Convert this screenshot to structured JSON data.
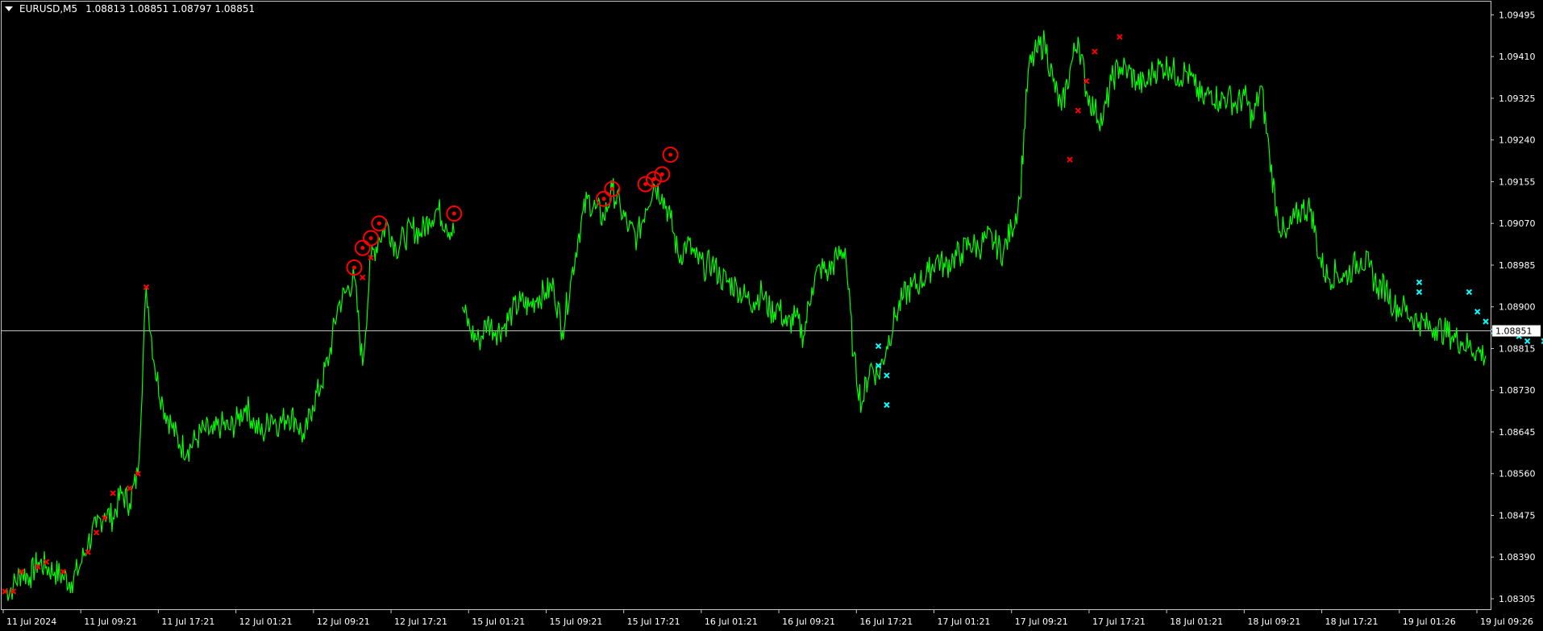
{
  "header": {
    "symbol": "EURUSD,M5",
    "ohlc": "1.08813 1.08851 1.08797 1.08851"
  },
  "colors": {
    "background": "#000000",
    "price_line": "#00ff00",
    "sell_marker": "#ff0000",
    "buy_marker": "#00ffff",
    "grid_text": "#ffffff",
    "bid_line": "#c0c0c0"
  },
  "chart_data": {
    "type": "line",
    "series": [
      {
        "values": [
          1.0832,
          1.0833,
          1.0836,
          1.0835,
          1.0838,
          1.0837,
          1.0836,
          1.0835,
          1.0834,
          1.0837,
          1.0842,
          1.0845,
          1.0848,
          1.0847,
          1.0852,
          1.085,
          1.0856,
          1.0894,
          1.0878,
          1.087,
          1.0866,
          1.0862,
          1.0861,
          1.0863,
          1.0865,
          1.0864,
          1.0866,
          1.0865,
          1.0867,
          1.087,
          1.0866,
          1.0864,
          1.0868,
          1.0866,
          1.0868,
          1.0867,
          1.0863,
          1.087,
          1.0874,
          1.088,
          1.089,
          1.0893,
          1.0896,
          1.0878,
          1.09,
          1.0904,
          1.0907,
          1.0902,
          1.0904,
          1.0906,
          1.0905,
          1.0908,
          1.091,
          1.0907,
          1.0905,
          1.089,
          1.0885,
          1.0883,
          1.0887,
          1.0885,
          1.0886,
          1.0889,
          1.0891,
          1.089,
          1.0892,
          1.0893,
          1.0894,
          1.0885,
          1.0895,
          1.0905,
          1.0912,
          1.091,
          1.0908,
          1.0914,
          1.091,
          1.0906,
          1.0904,
          1.091,
          1.0915,
          1.0913,
          1.0908,
          1.09,
          1.0903,
          1.09,
          1.0898,
          1.0899,
          1.0896,
          1.0895,
          1.0894,
          1.0892,
          1.0891,
          1.0893,
          1.0889,
          1.089,
          1.0886,
          1.0888,
          1.0884,
          1.0894,
          1.0898,
          1.0897,
          1.09,
          1.0902,
          1.088,
          1.087,
          1.0878,
          1.0876,
          1.0882,
          1.0888,
          1.0892,
          1.0894,
          1.0895,
          1.0897,
          1.09,
          1.0898,
          1.09,
          1.0901,
          1.0903,
          1.0902,
          1.0904,
          1.0903,
          1.0901,
          1.0906,
          1.0912,
          1.0938,
          1.0942,
          1.0944,
          1.0936,
          1.093,
          1.0938,
          1.0945,
          1.0934,
          1.093,
          1.0928,
          1.0936,
          1.0939,
          1.0938,
          1.0936,
          1.0935,
          1.0938,
          1.0939,
          1.0939,
          1.0937,
          1.0938,
          1.0935,
          1.0932,
          1.0934,
          1.0932,
          1.0933,
          1.0931,
          1.0933,
          1.0928,
          1.0935,
          1.0921,
          1.0908,
          1.0904,
          1.0908,
          1.091,
          1.091,
          1.09,
          1.0896,
          1.0897,
          1.0896,
          1.0898,
          1.09,
          1.0898,
          1.0894,
          1.0894,
          1.089,
          1.089,
          1.0888,
          1.0887,
          1.0886,
          1.0886,
          1.0885,
          1.0884,
          1.0883,
          1.0882,
          1.0881,
          1.088
        ]
      }
    ],
    "gap_after_index": 54,
    "x_ticks": [
      "11 Jul 2024",
      "11 Jul 09:21",
      "11 Jul 17:21",
      "12 Jul 01:21",
      "12 Jul 09:21",
      "12 Jul 17:21",
      "15 Jul 01:21",
      "15 Jul 09:21",
      "15 Jul 17:21",
      "16 Jul 01:21",
      "16 Jul 09:21",
      "16 Jul 17:21",
      "17 Jul 01:21",
      "17 Jul 09:21",
      "17 Jul 17:21",
      "18 Jul 01:21",
      "18 Jul 09:21",
      "18 Jul 17:21",
      "19 Jul 01:26",
      "19 Jul 09:26"
    ],
    "y_ticks": [
      "1.09495",
      "1.09410",
      "1.09325",
      "1.09240",
      "1.09155",
      "1.09070",
      "1.08985",
      "1.08900",
      "1.08815",
      "1.08730",
      "1.08645",
      "1.08560",
      "1.08475",
      "1.08390",
      "1.08305"
    ],
    "ylim": [
      1.08282,
      1.09522
    ],
    "current_price": "1.08851",
    "sell_markers": [
      [
        0,
        1.0832
      ],
      [
        1,
        1.0832
      ],
      [
        2,
        1.0836
      ],
      [
        4,
        1.0837
      ],
      [
        5,
        1.0838
      ],
      [
        7,
        1.0836
      ],
      [
        10,
        1.084
      ],
      [
        11,
        1.0844
      ],
      [
        12,
        1.0847
      ],
      [
        13,
        1.0852
      ],
      [
        15,
        1.0853
      ],
      [
        16,
        1.0856
      ],
      [
        17,
        1.0894
      ],
      [
        43,
        1.0896
      ],
      [
        44,
        1.09
      ],
      [
        128,
        1.092
      ],
      [
        129,
        1.093
      ],
      [
        130,
        1.0936
      ],
      [
        131,
        1.0942
      ],
      [
        134,
        1.0945
      ]
    ],
    "sell_circles": [
      [
        42,
        1.0898
      ],
      [
        43,
        1.0902
      ],
      [
        44,
        1.0904
      ],
      [
        45,
        1.0907
      ],
      [
        54,
        1.0909
      ],
      [
        72,
        1.0912
      ],
      [
        73,
        1.0914
      ],
      [
        77,
        1.0915
      ],
      [
        78,
        1.0916
      ],
      [
        79,
        1.0917
      ],
      [
        80,
        1.0921
      ]
    ],
    "buy_markers": [
      [
        105,
        1.0882
      ],
      [
        105,
        1.0878
      ],
      [
        106,
        1.0876
      ],
      [
        106,
        1.087
      ],
      [
        170,
        1.0895
      ],
      [
        170,
        1.0893
      ],
      [
        176,
        1.0893
      ],
      [
        177,
        1.0889
      ],
      [
        178,
        1.0887
      ],
      [
        179,
        1.0885
      ],
      [
        182,
        1.0884
      ],
      [
        183,
        1.0883
      ],
      [
        185,
        1.0883
      ],
      [
        186,
        1.0882
      ],
      [
        188,
        1.0881
      ],
      [
        189,
        1.088
      ]
    ]
  }
}
